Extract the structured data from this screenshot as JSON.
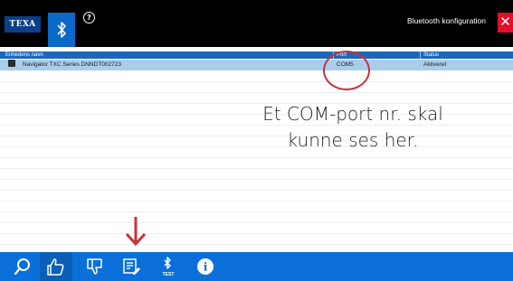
{
  "header": {
    "logo_text": "TEXA",
    "window_title": "Bluetooth konfiguration",
    "help_glyph": "?",
    "close_glyph": "✕",
    "icons": [
      "bluetooth-icon",
      "help-icon",
      "close-icon"
    ]
  },
  "table": {
    "columns": [
      "Enhedens navn",
      "Port",
      "Status"
    ],
    "rows": [
      {
        "name": "Navigator TXC Series DNNDT002723",
        "port": "COM5",
        "status": "Aktiveret",
        "selected": true
      }
    ]
  },
  "annotation": {
    "callout_line1": "Et COM-port nr. skal",
    "callout_line2": "kunne ses her.",
    "color": "#c8323a"
  },
  "toolbar": {
    "items": [
      {
        "icon": "search-icon"
      },
      {
        "icon": "thumbs-up-icon",
        "active": true
      },
      {
        "icon": "thumbs-down-icon"
      },
      {
        "icon": "edit-list-icon"
      },
      {
        "icon": "bluetooth-test-icon",
        "label": "TEST"
      },
      {
        "icon": "info-icon",
        "glyph": "i"
      }
    ]
  },
  "colors": {
    "accent": "#0a6fd8",
    "header_bg": "#000000",
    "selected_row": "#a9cdeb",
    "close": "#e0102a"
  }
}
